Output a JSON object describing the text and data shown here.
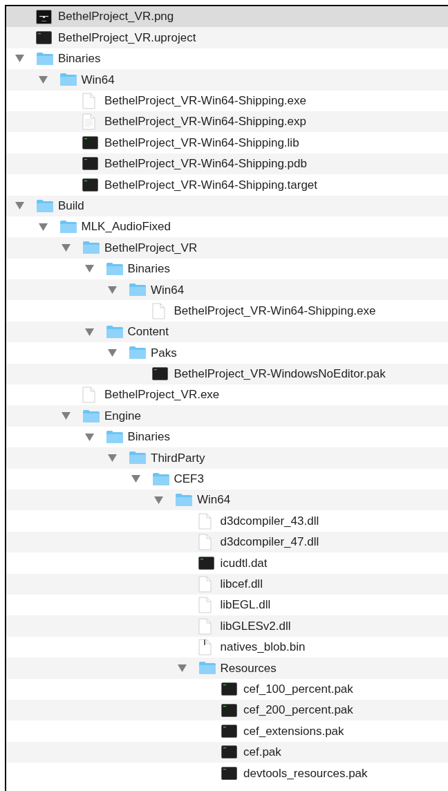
{
  "items": [
    {
      "name": "BethelProject_VR.png",
      "kind": "image",
      "selected": true
    },
    {
      "name": "BethelProject_VR.uproject",
      "kind": "terminal",
      "selected": false
    },
    {
      "name": "Binaries",
      "kind": "folder",
      "expanded": true,
      "selected": false,
      "children": [
        {
          "name": "Win64",
          "kind": "folder",
          "expanded": true,
          "selected": false,
          "children": [
            {
              "name": "BethelProject_VR-Win64-Shipping.exe",
              "kind": "blank",
              "selected": false
            },
            {
              "name": "BethelProject_VR-Win64-Shipping.exp",
              "kind": "text",
              "selected": false
            },
            {
              "name": "BethelProject_VR-Win64-Shipping.lib",
              "kind": "terminal",
              "selected": false
            },
            {
              "name": "BethelProject_VR-Win64-Shipping.pdb",
              "kind": "terminal",
              "selected": false
            },
            {
              "name": "BethelProject_VR-Win64-Shipping.target",
              "kind": "terminal",
              "selected": false
            }
          ]
        }
      ]
    },
    {
      "name": "Build",
      "kind": "folder",
      "expanded": true,
      "selected": false,
      "children": [
        {
          "name": "MLK_AudioFixed",
          "kind": "folder",
          "expanded": true,
          "selected": false,
          "children": [
            {
              "name": "BethelProject_VR",
              "kind": "folder",
              "expanded": true,
              "selected": false,
              "children": [
                {
                  "name": "Binaries",
                  "kind": "folder",
                  "expanded": true,
                  "selected": false,
                  "children": [
                    {
                      "name": "Win64",
                      "kind": "folder",
                      "expanded": true,
                      "selected": false,
                      "children": [
                        {
                          "name": "BethelProject_VR-Win64-Shipping.exe",
                          "kind": "blank",
                          "selected": false
                        }
                      ]
                    }
                  ]
                },
                {
                  "name": "Content",
                  "kind": "folder",
                  "expanded": true,
                  "selected": false,
                  "children": [
                    {
                      "name": "Paks",
                      "kind": "folder",
                      "expanded": true,
                      "selected": false,
                      "children": [
                        {
                          "name": "BethelProject_VR-WindowsNoEditor.pak",
                          "kind": "terminal",
                          "selected": false
                        }
                      ]
                    }
                  ]
                }
              ]
            },
            {
              "name": "BethelProject_VR.exe",
              "kind": "blank",
              "selected": false
            },
            {
              "name": "Engine",
              "kind": "folder",
              "expanded": true,
              "selected": false,
              "children": [
                {
                  "name": "Binaries",
                  "kind": "folder",
                  "expanded": true,
                  "selected": false,
                  "children": [
                    {
                      "name": "ThirdParty",
                      "kind": "folder",
                      "expanded": true,
                      "selected": false,
                      "children": [
                        {
                          "name": "CEF3",
                          "kind": "folder",
                          "expanded": true,
                          "selected": false,
                          "children": [
                            {
                              "name": "Win64",
                              "kind": "folder",
                              "expanded": true,
                              "selected": false,
                              "children": [
                                {
                                  "name": "d3dcompiler_43.dll",
                                  "kind": "blank",
                                  "selected": false
                                },
                                {
                                  "name": "d3dcompiler_47.dll",
                                  "kind": "blank",
                                  "selected": false
                                },
                                {
                                  "name": "icudtl.dat",
                                  "kind": "terminal",
                                  "selected": false
                                },
                                {
                                  "name": "libcef.dll",
                                  "kind": "blank",
                                  "selected": false
                                },
                                {
                                  "name": "libEGL.dll",
                                  "kind": "blank",
                                  "selected": false
                                },
                                {
                                  "name": "libGLESv2.dll",
                                  "kind": "blank",
                                  "selected": false
                                },
                                {
                                  "name": "natives_blob.bin",
                                  "kind": "archive",
                                  "selected": false
                                },
                                {
                                  "name": "Resources",
                                  "kind": "folder",
                                  "expanded": true,
                                  "selected": false,
                                  "children": [
                                    {
                                      "name": "cef_100_percent.pak",
                                      "kind": "terminal",
                                      "selected": false
                                    },
                                    {
                                      "name": "cef_200_percent.pak",
                                      "kind": "terminal",
                                      "selected": false
                                    },
                                    {
                                      "name": "cef_extensions.pak",
                                      "kind": "terminal",
                                      "selected": false
                                    },
                                    {
                                      "name": "cef.pak",
                                      "kind": "terminal",
                                      "selected": false
                                    },
                                    {
                                      "name": "devtools_resources.pak",
                                      "kind": "terminal",
                                      "selected": false
                                    }
                                  ]
                                }
                              ]
                            }
                          ]
                        }
                      ]
                    }
                  ]
                }
              ]
            }
          ]
        }
      ]
    }
  ]
}
